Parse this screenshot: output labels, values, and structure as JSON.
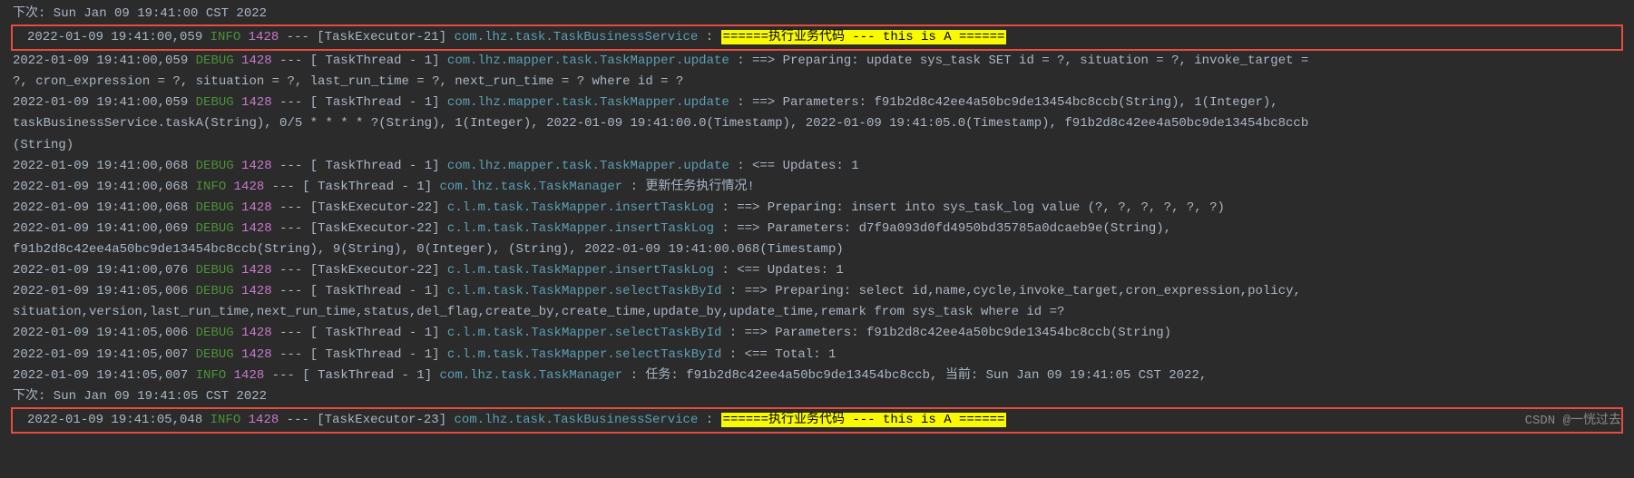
{
  "lines": [
    {
      "type": "cont",
      "text": "下次: Sun Jan 09 19:41:00 CST 2022"
    },
    {
      "type": "boxed",
      "timestamp": "2022-01-09 19:41:00,059",
      "level": "INFO",
      "pid": "1428",
      "thread": "[TaskExecutor-21]",
      "logger": "com.lhz.task.TaskBusinessService",
      "colon": ": ",
      "highlighted": "======执行业务代码 --- this is A ======"
    },
    {
      "type": "log",
      "timestamp": "2022-01-09 19:41:00,059",
      "level": "DEBUG",
      "pid": "1428",
      "thread": "[ TaskThread - 1]",
      "logger": "com.lhz.mapper.task.TaskMapper.update",
      "colon": ": ",
      "message": "==>  Preparing: update sys_task SET id = ?, situation = ?, invoke_target ="
    },
    {
      "type": "cont",
      "text": " ?, cron_expression = ?, situation = ?, last_run_time = ?, next_run_time = ? where id = ?"
    },
    {
      "type": "log",
      "timestamp": "2022-01-09 19:41:00,059",
      "level": "DEBUG",
      "pid": "1428",
      "thread": "[ TaskThread - 1]",
      "logger": "com.lhz.mapper.task.TaskMapper.update",
      "colon": ": ",
      "message": "==> Parameters: f91b2d8c42ee4a50bc9de13454bc8ccb(String), 1(Integer),"
    },
    {
      "type": "cont",
      "text": " taskBusinessService.taskA(String), 0/5 * * * * ?(String), 1(Integer), 2022-01-09 19:41:00.0(Timestamp), 2022-01-09 19:41:05.0(Timestamp), f91b2d8c42ee4a50bc9de13454bc8ccb"
    },
    {
      "type": "cont",
      "text": "(String)"
    },
    {
      "type": "log",
      "timestamp": "2022-01-09 19:41:00,068",
      "level": "DEBUG",
      "pid": "1428",
      "thread": "[ TaskThread - 1]",
      "logger": "com.lhz.mapper.task.TaskMapper.update",
      "colon": ": ",
      "message": "<==    Updates: 1"
    },
    {
      "type": "log",
      "timestamp": "2022-01-09 19:41:00,068",
      "level": "INFO",
      "pid": "1428",
      "thread": "[ TaskThread - 1]",
      "logger": "com.lhz.task.TaskManager",
      "colon": ": ",
      "message": "更新任务执行情况!"
    },
    {
      "type": "log",
      "timestamp": "2022-01-09 19:41:00,068",
      "level": "DEBUG",
      "pid": "1428",
      "thread": "[TaskExecutor-22]",
      "logger": "c.l.m.task.TaskMapper.insertTaskLog",
      "colon": ": ",
      "message": "==>  Preparing: insert into sys_task_log value (?, ?, ?, ?, ?, ?)"
    },
    {
      "type": "log",
      "timestamp": "2022-01-09 19:41:00,069",
      "level": "DEBUG",
      "pid": "1428",
      "thread": "[TaskExecutor-22]",
      "logger": "c.l.m.task.TaskMapper.insertTaskLog",
      "colon": ": ",
      "message": "==> Parameters: d7f9a093d0fd4950bd35785a0dcaeb9e(String),"
    },
    {
      "type": "cont",
      "text": " f91b2d8c42ee4a50bc9de13454bc8ccb(String), 9(String), 0(Integer), (String), 2022-01-09 19:41:00.068(Timestamp)"
    },
    {
      "type": "log",
      "timestamp": "2022-01-09 19:41:00,076",
      "level": "DEBUG",
      "pid": "1428",
      "thread": "[TaskExecutor-22]",
      "logger": "c.l.m.task.TaskMapper.insertTaskLog",
      "colon": ": ",
      "message": "<==    Updates: 1"
    },
    {
      "type": "log",
      "timestamp": "2022-01-09 19:41:05,006",
      "level": "DEBUG",
      "pid": "1428",
      "thread": "[ TaskThread - 1]",
      "logger": "c.l.m.task.TaskMapper.selectTaskById",
      "colon": ": ",
      "message": "==>  Preparing: select id,name,cycle,invoke_target,cron_expression,policy,"
    },
    {
      "type": "cont",
      "text": " situation,version,last_run_time,next_run_time,status,del_flag,create_by,create_time,update_by,update_time,remark from sys_task where id =?"
    },
    {
      "type": "log",
      "timestamp": "2022-01-09 19:41:05,006",
      "level": "DEBUG",
      "pid": "1428",
      "thread": "[ TaskThread - 1]",
      "logger": "c.l.m.task.TaskMapper.selectTaskById",
      "colon": ": ",
      "message": "==> Parameters: f91b2d8c42ee4a50bc9de13454bc8ccb(String)"
    },
    {
      "type": "log",
      "timestamp": "2022-01-09 19:41:05,007",
      "level": "DEBUG",
      "pid": "1428",
      "thread": "[ TaskThread - 1]",
      "logger": "c.l.m.task.TaskMapper.selectTaskById",
      "colon": ": ",
      "message": "<==      Total: 1"
    },
    {
      "type": "log",
      "timestamp": "2022-01-09 19:41:05,007",
      "level": "INFO",
      "pid": "1428",
      "thread": "[ TaskThread - 1]",
      "logger": "com.lhz.task.TaskManager",
      "colon": ": ",
      "message": "任务: f91b2d8c42ee4a50bc9de13454bc8ccb, 当前: Sun Jan 09 19:41:05 CST 2022,"
    },
    {
      "type": "cont",
      "text": " 下次: Sun Jan 09 19:41:05 CST 2022"
    },
    {
      "type": "boxed",
      "timestamp": "2022-01-09 19:41:05,048",
      "level": "INFO",
      "pid": "1428",
      "thread": "[TaskExecutor-23]",
      "logger": "com.lhz.task.TaskBusinessService",
      "colon": ": ",
      "highlighted": "======执行业务代码 --- this is A ======"
    }
  ],
  "watermark": "CSDN @一恍过去",
  "logger_pad_width": 40
}
